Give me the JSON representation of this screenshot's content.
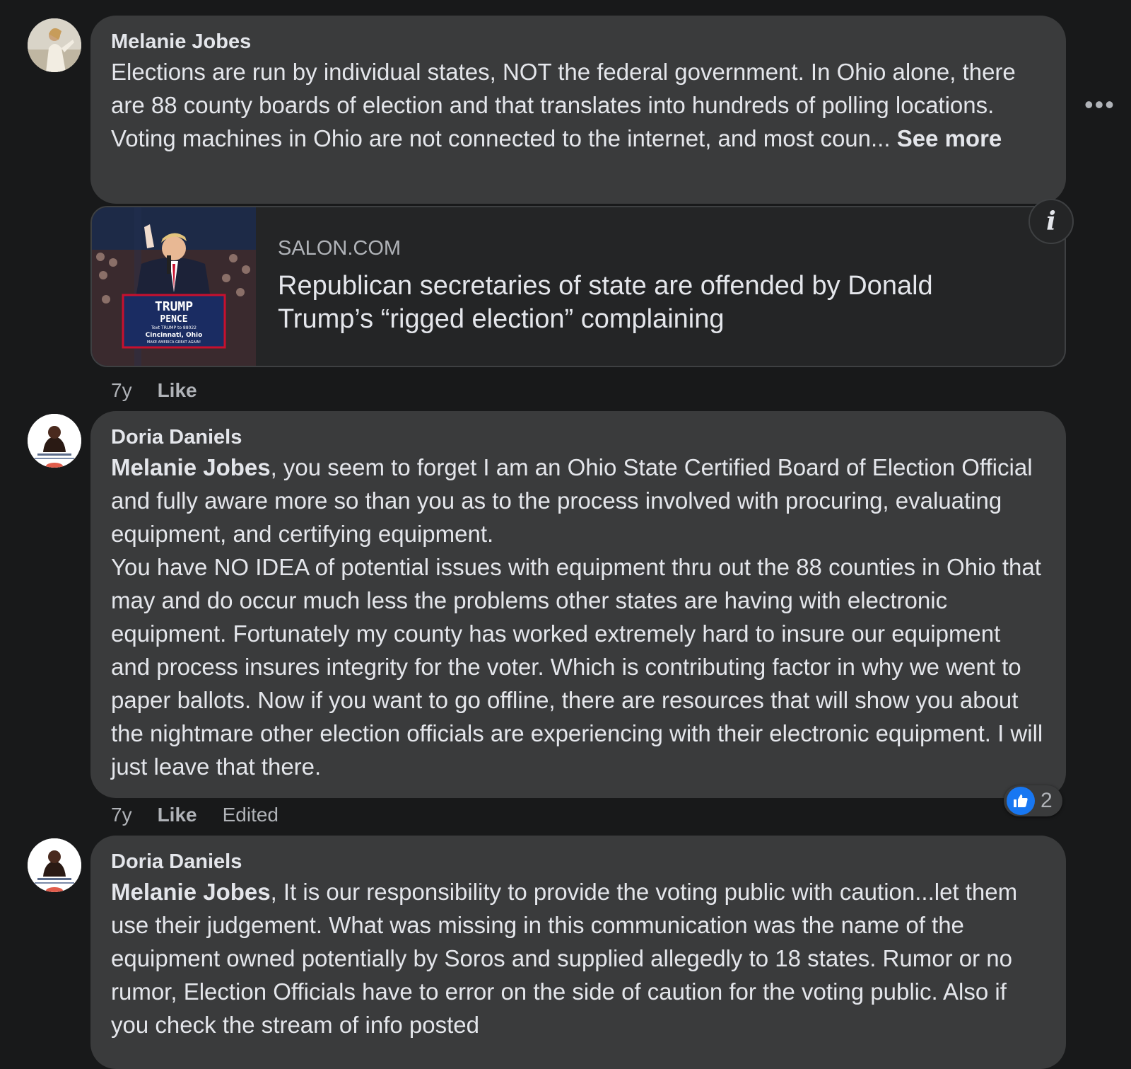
{
  "comments": [
    {
      "author": "Melanie Jobes",
      "text": "Elections are run by individual states, NOT the federal government. In Ohio alone, there are 88 county boards of election and that translates into hundreds of polling locations. Voting machines in Ohio are not connected to the internet, and most coun... ",
      "see_more": "See more",
      "time": "7y",
      "like": "Like"
    },
    {
      "author": "Doria Daniels",
      "mention": "Melanie Jobes",
      "text": ", you seem to forget I am an Ohio State Certified Board of Election Official and fully aware more so than you as to the process involved with procuring, evaluating equipment, and certifying equipment.",
      "text2": "You have NO IDEA of potential issues with equipment thru out the 88 counties in Ohio that may and do occur much less the problems other states are having with electronic equipment. Fortunately my county has worked extremely hard to insure our equipment and process insures integrity for the voter. Which is contributing factor in why we went to paper ballots. Now if you want to go offline, there are resources that will show you about the nightmare other election officials are experiencing with their electronic equipment. I will just leave that there.",
      "time": "7y",
      "like": "Like",
      "edited": "Edited",
      "reaction_count": "2"
    },
    {
      "author": "Doria Daniels",
      "mention": "Melanie Jobes",
      "text": ", It is our responsibility to provide the voting public with caution...let them use their judgement. What was missing in this communication was the name of the equipment owned potentially by Soros and supplied allegedly to 18 states. Rumor or no rumor, Election Officials have to error on the side of caution for the voting public. Also if you check the stream of info posted"
    }
  ],
  "link_preview": {
    "domain": "SALON.COM",
    "title": "Republican secretaries of state are offended by Donald Trump’s “rigged election” complaining",
    "sign_line1": "TRUMP",
    "sign_line2": "PENCE",
    "sign_line3": "Text TRUMP to 88022",
    "sign_line4": "Cincinnati, Ohio",
    "sign_line5": "MAKE AMERICA GREAT AGAIN!"
  },
  "icons": {
    "more": "more-options-icon",
    "info": "info-icon",
    "like": "thumbs-up-icon"
  },
  "colors": {
    "background": "#18191a",
    "bubble": "#3a3b3c",
    "accent": "#1877f2"
  }
}
